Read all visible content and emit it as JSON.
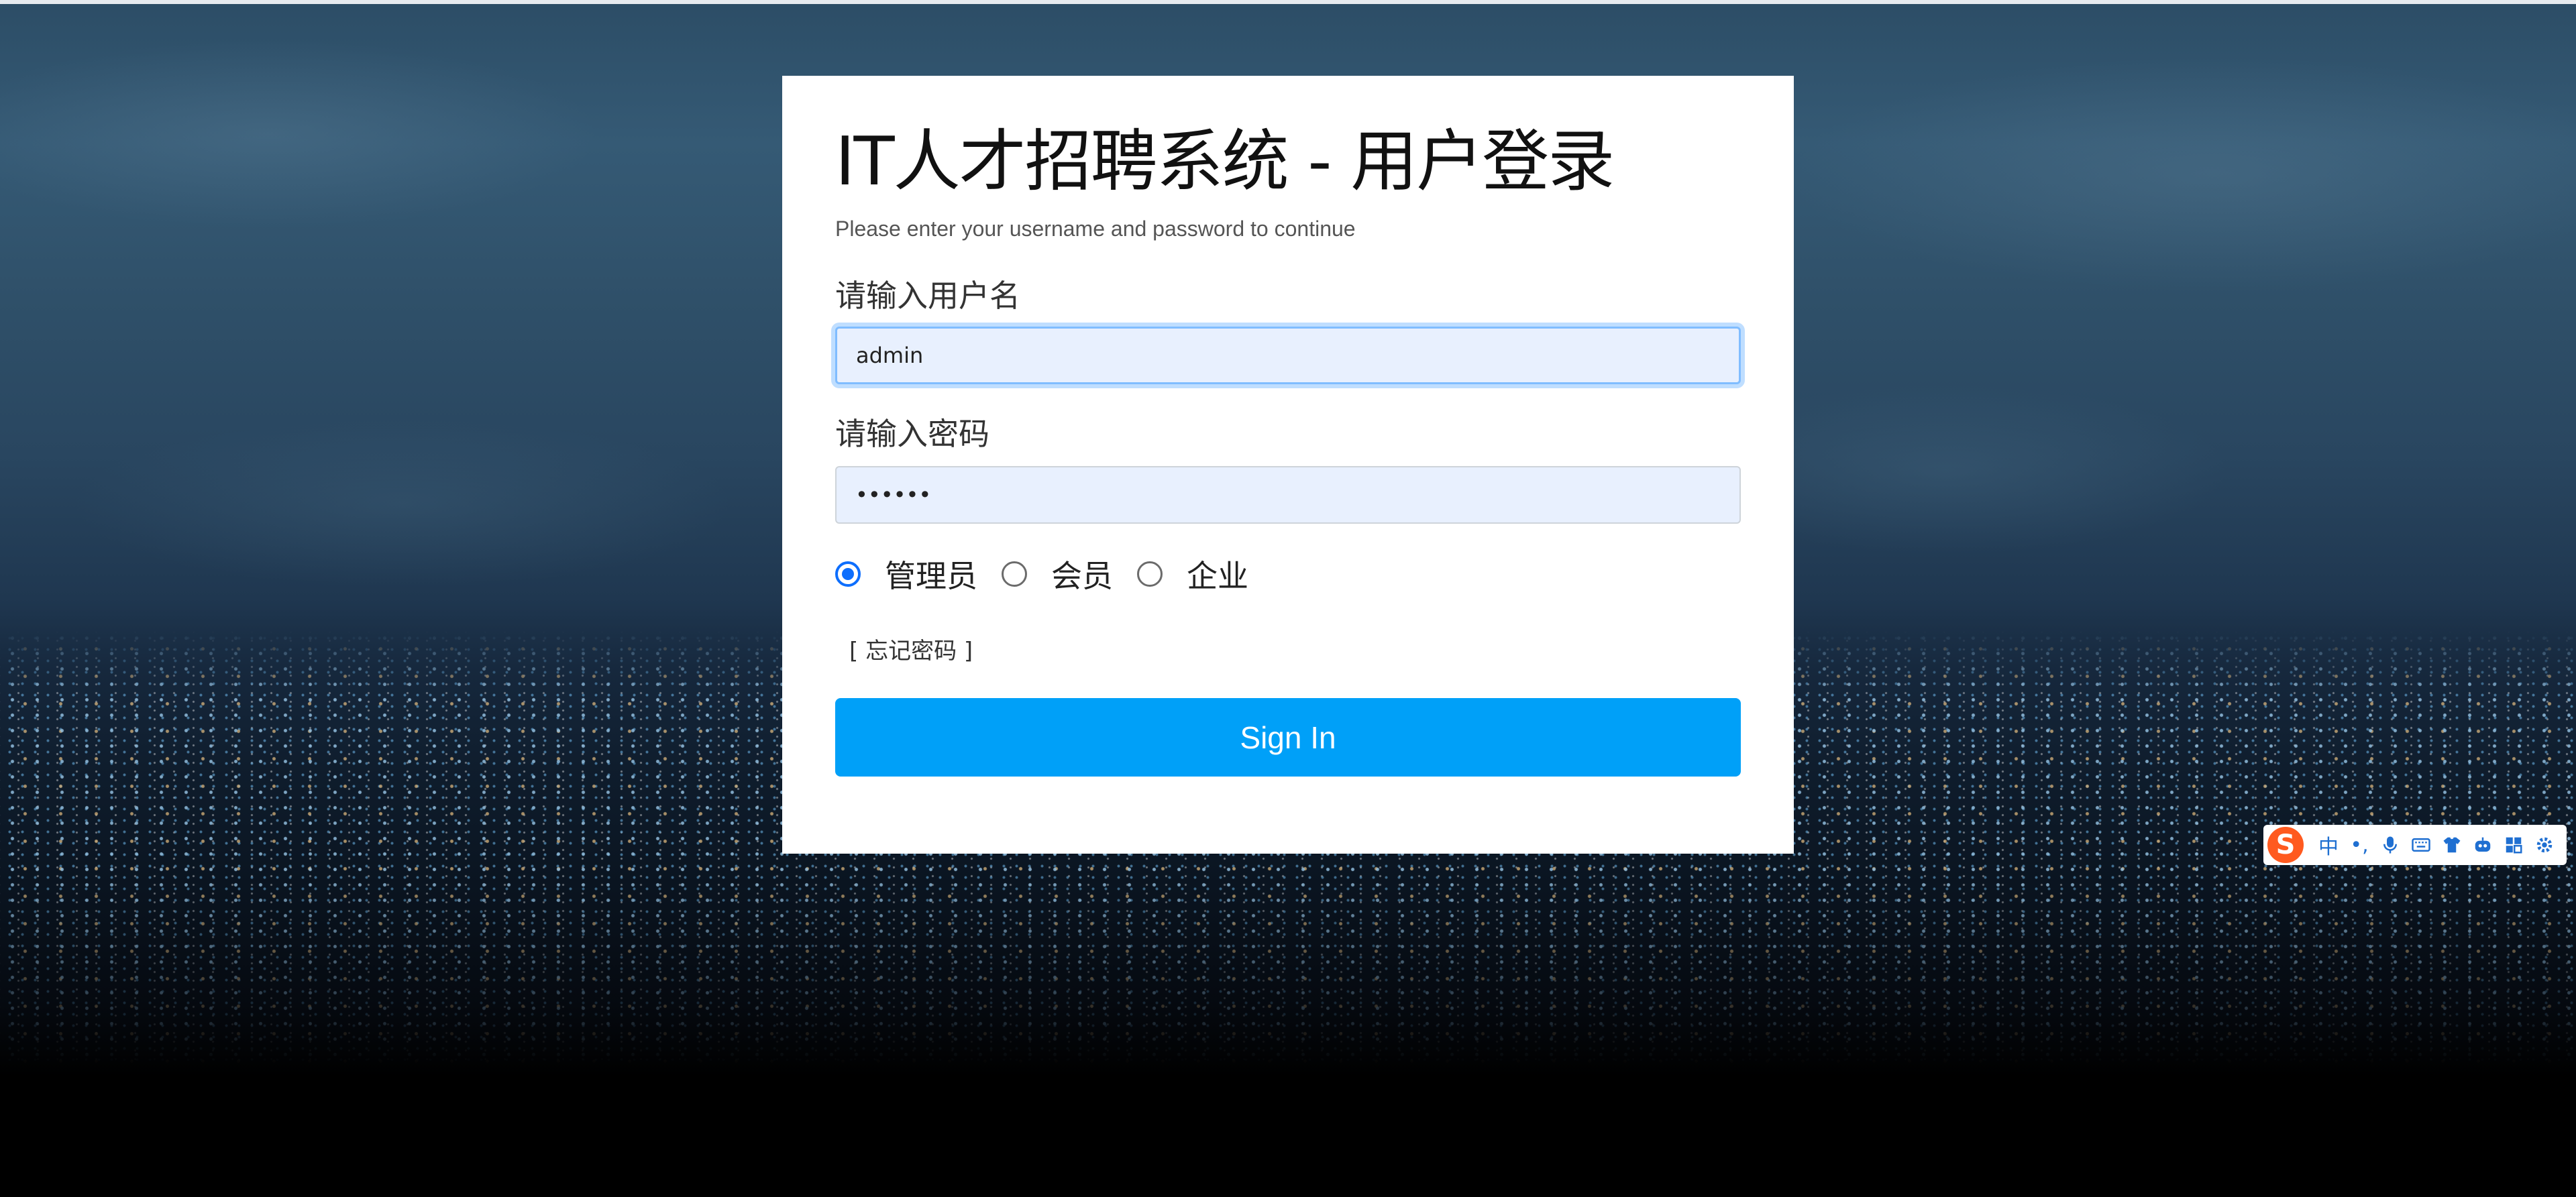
{
  "login": {
    "title": "IT人才招聘系统 - 用户登录",
    "subtitle": "Please enter your username and password to continue",
    "username_label": "请输入用户名",
    "username_value": "admin",
    "password_label": "请输入密码",
    "password_value": "••••••",
    "roles": [
      "管理员",
      "会员",
      "企业"
    ],
    "selected_role": "管理员",
    "forgot_password": "[ 忘记密码 ]",
    "signin_label": "Sign In"
  },
  "ime_toolbar": {
    "logo": "S",
    "mode": "中",
    "punct": "•,",
    "icons": [
      "microphone-icon",
      "keyboard-icon",
      "skin-icon",
      "robot-icon",
      "toolbox-icon",
      "settings-icon"
    ]
  },
  "colors": {
    "primary_button": "#00a0f8",
    "input_bg": "#e8f0fe",
    "radio_checked": "#0d6efd",
    "ime_accent": "#1f6fd1",
    "ime_logo": "#ff5a1f"
  }
}
